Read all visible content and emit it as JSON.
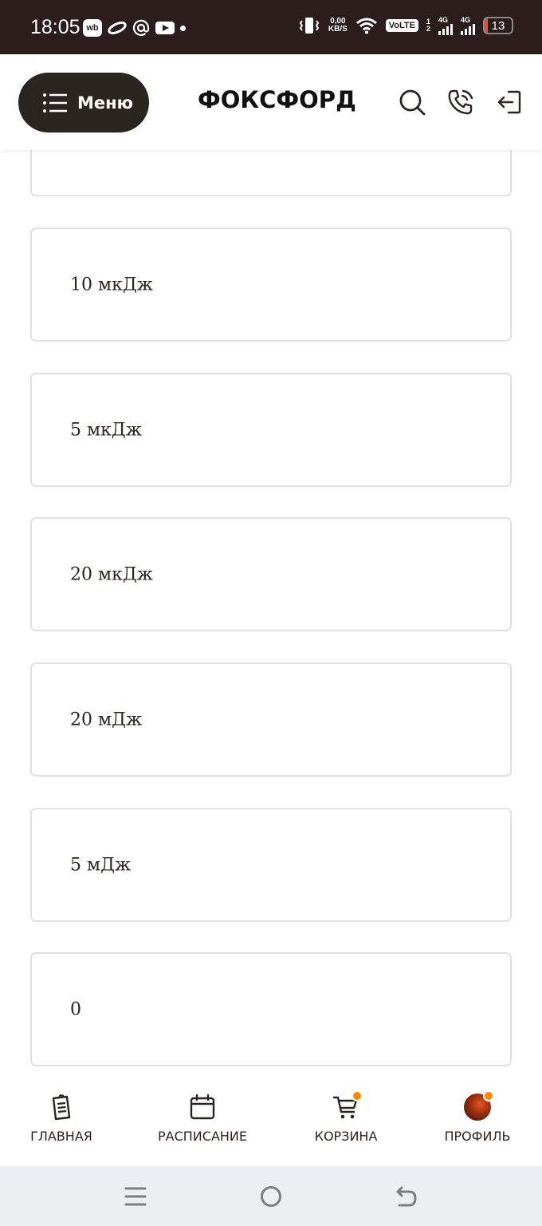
{
  "status_bar": {
    "time": "18:05",
    "wb_badge": "wb",
    "net_speed_value": "0,00",
    "net_speed_unit": "KB/S",
    "volte": "VoLTE",
    "sim1_label": "1",
    "sim2_label": "2",
    "network1": "4G",
    "network2": "4G",
    "battery": "13",
    "battery_level_percent": 13,
    "icons": [
      "wb-icon",
      "infinity-icon",
      "at-icon",
      "youtube-icon",
      "dot-icon",
      "vibrate-icon",
      "wifi-icon",
      "signal-icon",
      "battery-icon"
    ]
  },
  "header": {
    "menu_label": "Меню",
    "logo": "ФОКСФОРД",
    "icons": [
      "search-icon",
      "phone-icon",
      "login-icon"
    ]
  },
  "options": [
    {
      "label": ""
    },
    {
      "label": "10 мкДж"
    },
    {
      "label": "5 мкДж"
    },
    {
      "label": "20 мкДж"
    },
    {
      "label": "20 мДж"
    },
    {
      "label": "5 мДж"
    },
    {
      "label": "0"
    }
  ],
  "bottom_nav": {
    "items": [
      {
        "label": "ГЛАВНАЯ",
        "icon": "document-icon"
      },
      {
        "label": "РАСПИСАНИЕ",
        "icon": "calendar-icon"
      },
      {
        "label": "КОРЗИНА",
        "icon": "cart-icon"
      },
      {
        "label": "ПРОФИЛЬ",
        "icon": "avatar-icon"
      }
    ],
    "badge_color": "#ff8a00"
  },
  "system_nav": {
    "icons": [
      "recent-apps-icon",
      "home-circle-icon",
      "back-icon"
    ]
  },
  "colors": {
    "status_bar_bg": "#2b1d1b",
    "menu_button_bg": "#2b2520",
    "option_border": "#e3e1df",
    "system_nav_bg": "#eceef2"
  }
}
